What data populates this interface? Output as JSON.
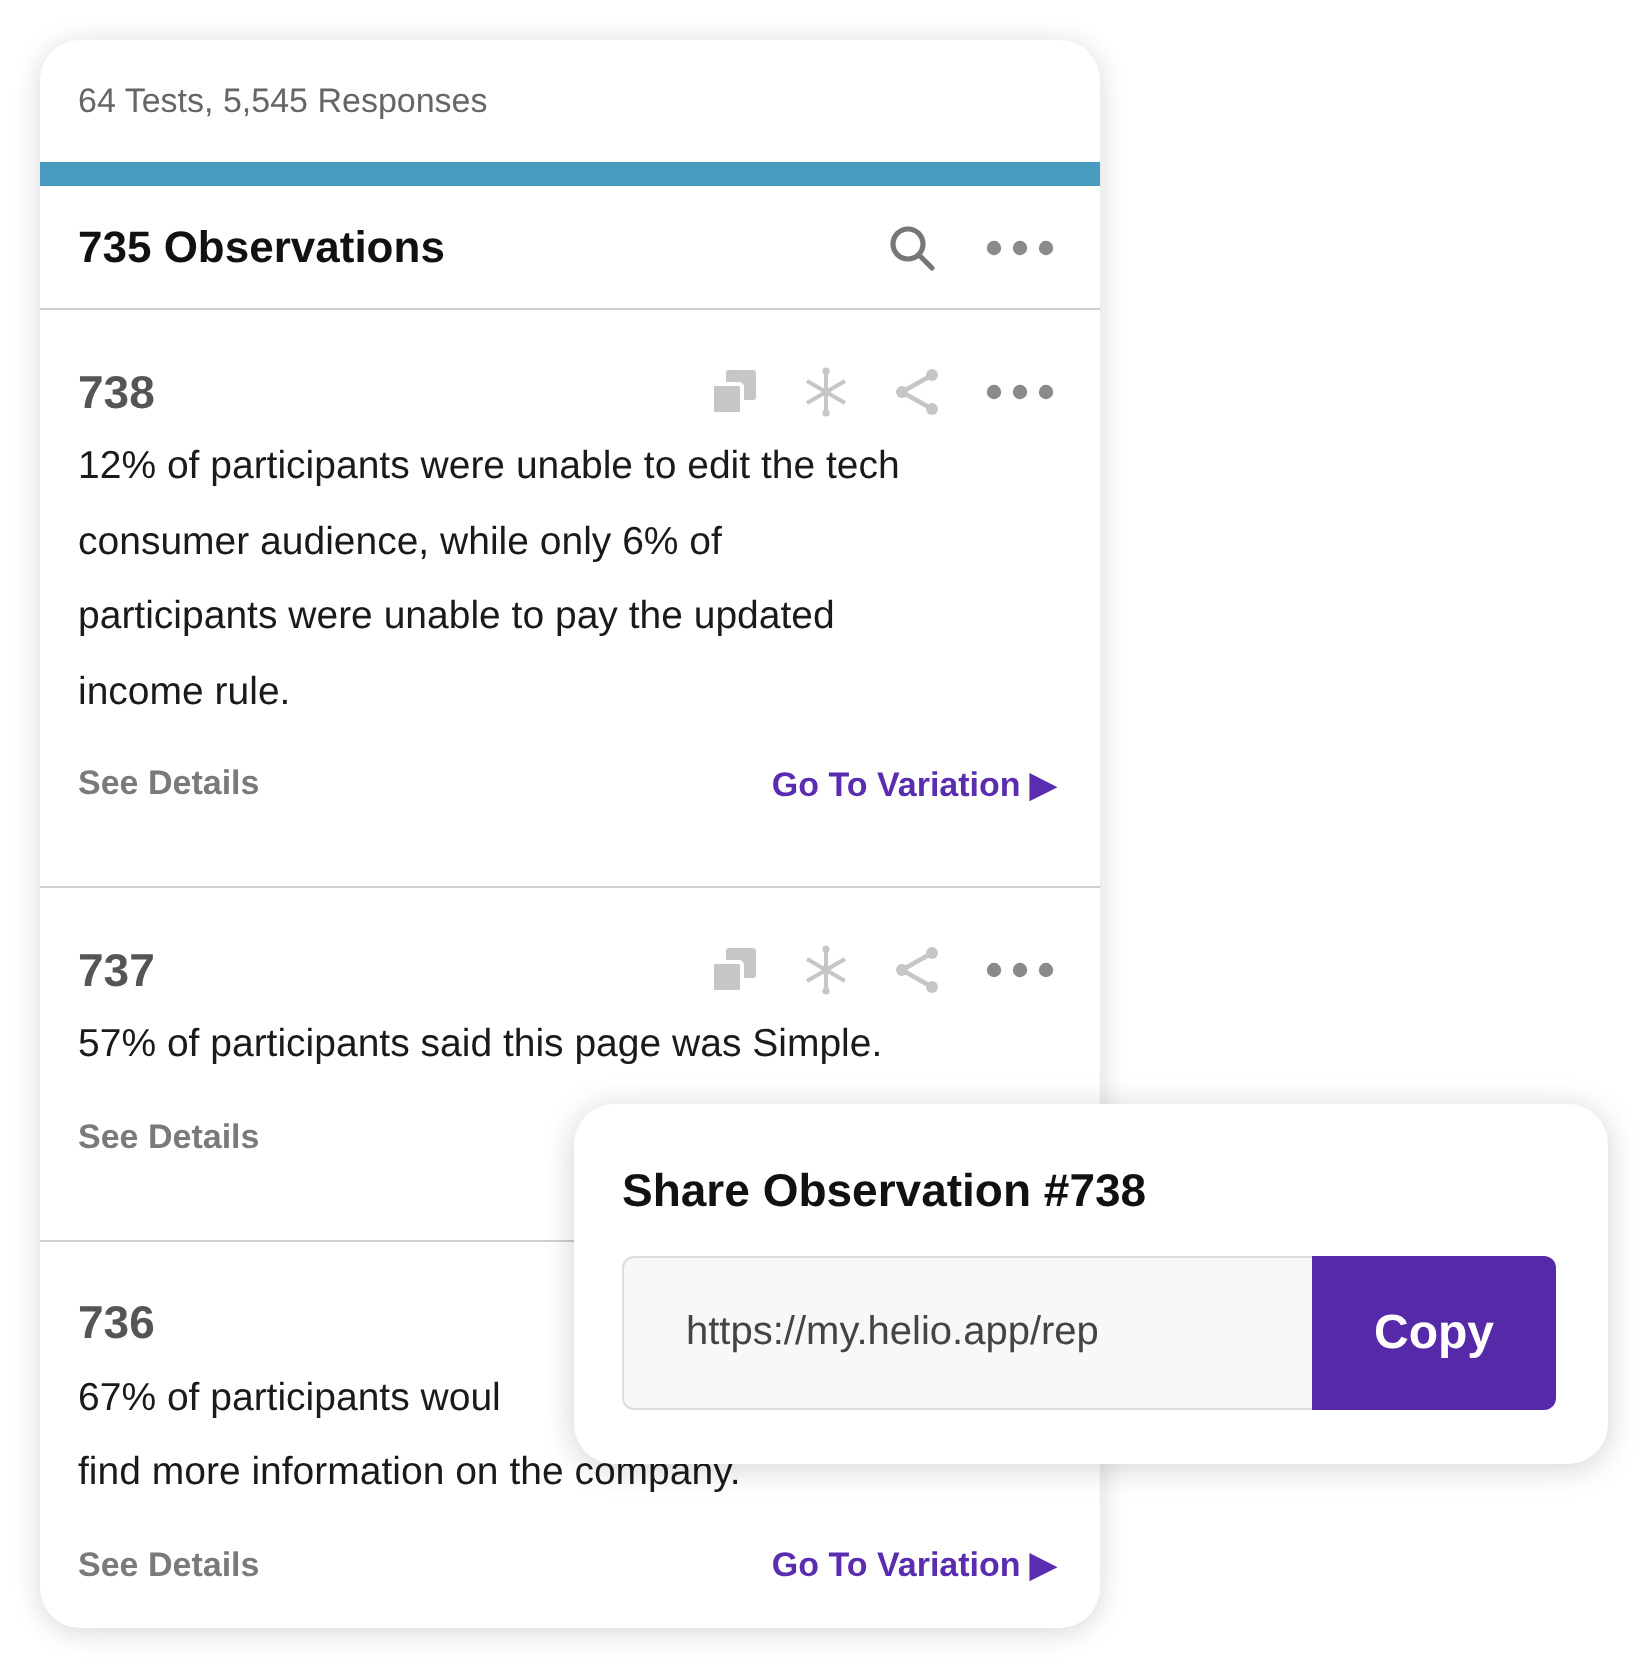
{
  "summary": "64 Tests, 5,545 Responses",
  "header": {
    "title": "735 Observations"
  },
  "observations": [
    {
      "number": "738",
      "lines": [
        "12% of participants were unable to edit the tech",
        "consumer audience, while only 6% of",
        "participants were unable to pay the updated",
        "income rule."
      ],
      "actions": true,
      "details_link": "See Details",
      "variation_link": "Go To Variation ▶"
    },
    {
      "number": "737",
      "lines": [
        "57% of participants said this page was Simple."
      ],
      "actions": true,
      "details_link": "See Details"
    },
    {
      "number": "736",
      "lines": [
        "67% of participants woul",
        "find more information on the company."
      ],
      "details_link": "See Details",
      "variation_link": "Go To Variation ▶"
    }
  ],
  "share_popup": {
    "title": "Share Observation #738",
    "url": "https://my.helio.app/rep",
    "button": "Copy"
  }
}
